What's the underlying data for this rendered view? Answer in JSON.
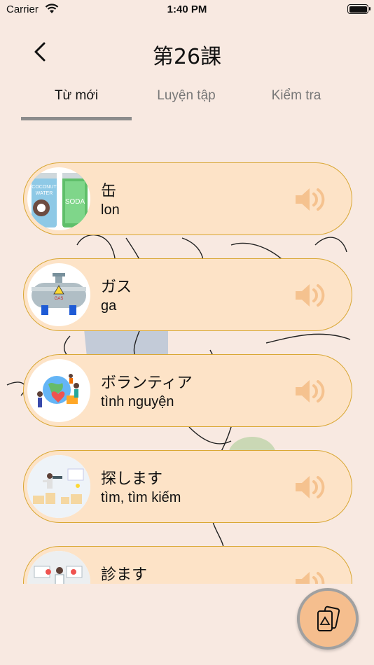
{
  "status_bar": {
    "carrier": "Carrier",
    "time": "1:40 PM"
  },
  "header": {
    "title": "第26課"
  },
  "tabs": [
    {
      "label": "Từ mới",
      "active": true
    },
    {
      "label": "Luyện tập",
      "active": false
    },
    {
      "label": "Kiểm tra",
      "active": false
    }
  ],
  "vocab": [
    {
      "jp": "缶",
      "vi": "lon",
      "image": "cans-image"
    },
    {
      "jp": "ガス",
      "vi": "ga",
      "image": "gas-tank-image"
    },
    {
      "jp": "ボランティア",
      "vi": "tình nguyện",
      "image": "volunteer-image"
    },
    {
      "jp": "探します",
      "vi": "tìm, tìm kiếm",
      "image": "search-image"
    },
    {
      "jp": "診ます",
      "vi": "",
      "image": "doctor-image"
    }
  ],
  "thumb_text": {
    "coconut": "COCONUT",
    "water": "WATER",
    "soda": "SODA",
    "gas": "GAS"
  },
  "colors": {
    "background": "#f8e9e1",
    "card": "#fde3c7",
    "card_border": "#d9a733",
    "speaker": "#f5c28f",
    "fab": "#f5be8e"
  }
}
